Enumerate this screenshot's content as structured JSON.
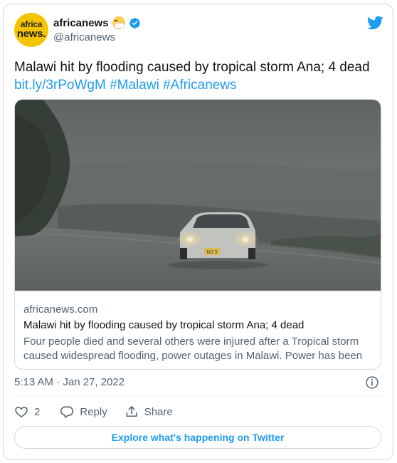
{
  "author": {
    "avatar_line1": "africa",
    "avatar_line2": "news.",
    "name": "africanews",
    "handle": "@africanews",
    "emoji_icon": "face-with-medical-mask-icon",
    "verified_icon": "verified-badge-icon"
  },
  "tweet": {
    "text": "Malawi hit by flooding caused by tropical storm Ana; 4 dead",
    "link": "bit.ly/3rPoWgM",
    "hashtag1": "#Malawi",
    "hashtag2": "#Africanews"
  },
  "link_card": {
    "domain": "africanews.com",
    "title": "Malawi hit by flooding caused by tropical storm Ana; 4 dead",
    "description": "Four people died and several others were injured after a Tropical storm caused widespread flooding, power outages in Malawi. Power has been …",
    "plate": "MJ 5"
  },
  "timestamp": "5:13 AM · Jan 27, 2022",
  "actions": {
    "like_count": "2",
    "reply_label": "Reply",
    "share_label": "Share"
  },
  "explore_label": "Explore what's happening on Twitter",
  "colors": {
    "accent": "#1d9bf0",
    "secondary_text": "#536471",
    "border": "#cfd9de"
  }
}
